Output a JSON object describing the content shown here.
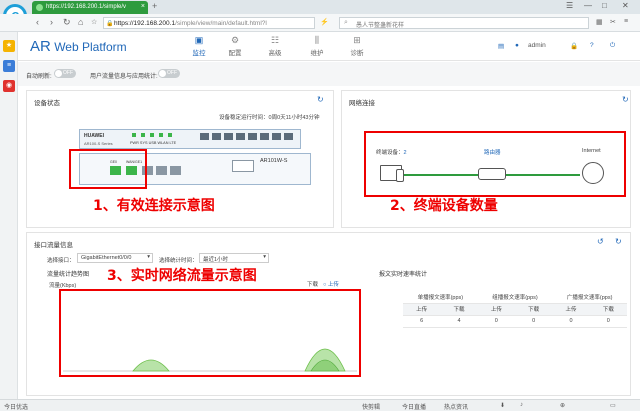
{
  "browser": {
    "tab_title": "https://192.168.200.1/simple/v",
    "url_host": "https://192.168.200.1",
    "url_path": "/simple/view/main/default.html?l",
    "search_placeholder": "愚人节整蛊新花样",
    "new_tab": "+",
    "close_tab": "×"
  },
  "app": {
    "brand_ar": "AR",
    "brand_name": "Web Platform",
    "nav": [
      {
        "label": "监控",
        "icon": "monitor-icon"
      },
      {
        "label": "配置",
        "icon": "gear-icon"
      },
      {
        "label": "高级",
        "icon": "sliders-icon"
      },
      {
        "label": "维护",
        "icon": "tools-icon"
      },
      {
        "label": "诊断",
        "icon": "briefcase-icon"
      }
    ],
    "user": "admin"
  },
  "toggles": {
    "auto_refresh_label": "自动刷新:",
    "auto_refresh_value": "OFF",
    "user_traffic_label": "用户流量信息与应用统计:",
    "user_traffic_value": "OFF"
  },
  "device_status": {
    "title": "设备状态",
    "uptime_label": "设备稳定运行时间：",
    "uptime_value": "0周0天11小时43分钟",
    "brand": "HUAWEI",
    "series": "AR100-S Series",
    "model": "AR101W-S",
    "indicators": [
      "PWR",
      "SYS",
      "USB",
      "WLAN",
      "LTE"
    ],
    "port_labels": [
      "GE0",
      "WAN/GE1"
    ]
  },
  "network": {
    "title": "网络连接",
    "terminal_label": "终端设备：",
    "terminal_count": "2",
    "router_label": "路由器",
    "internet_label": "Internet"
  },
  "traffic": {
    "title": "接口流量信息",
    "interface_label": "选择接口：",
    "interface_value": "GigabitEthernet0/0/0",
    "period_label": "选择统计时间：",
    "period_value": "最近1小时",
    "chart_title": "流量统计趋势图",
    "y_unit": "流量(Kbps)",
    "legend_down": "下载",
    "legend_up": "上传",
    "realtime_title": "报文实时速率统计",
    "table_headers": [
      "单播报文速率(pps)",
      "组播报文速率(pps)",
      "广播报文速率(pps)"
    ],
    "table_sub": [
      "上传",
      "下载",
      "上传",
      "下载",
      "上传",
      "下载"
    ],
    "table_values": [
      "6",
      "4",
      "0",
      "0",
      "0",
      "0"
    ]
  },
  "annotations": {
    "a1": "1、有效连接示意图",
    "a2": "2、终端设备数量",
    "a3": "3、实时网络流量示意图"
  },
  "statusbar": {
    "left": "今日优选",
    "items": [
      "快剪辑",
      "今日直播",
      "热点资讯"
    ]
  },
  "colors": {
    "brand_blue": "#2168b8",
    "green": "#2e9b3e",
    "annotation_red": "#ee0000"
  }
}
